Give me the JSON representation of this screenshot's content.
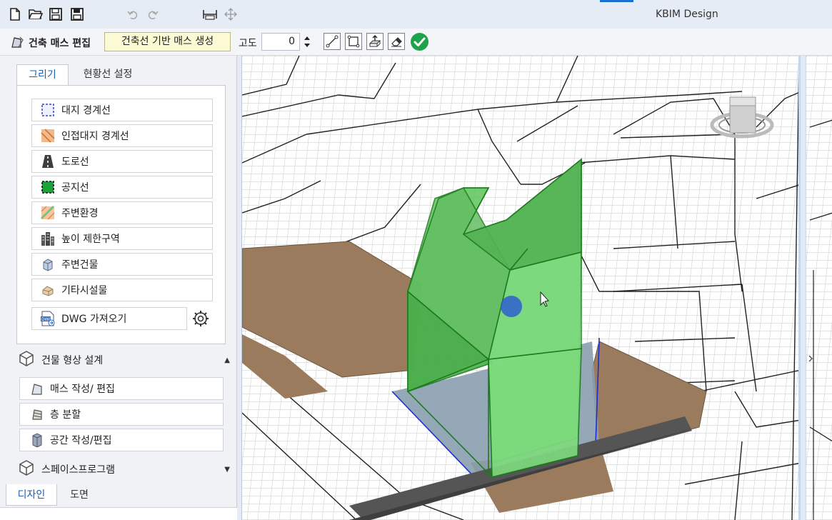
{
  "app": {
    "title": "KBIM Design"
  },
  "quick_access": [
    {
      "name": "new-file-icon"
    },
    {
      "name": "open-folder-icon"
    },
    {
      "name": "save-icon"
    },
    {
      "name": "save-all-icon"
    },
    {
      "name": "undo-icon"
    },
    {
      "name": "redo-icon"
    },
    {
      "name": "measure-icon"
    },
    {
      "name": "move-icon"
    }
  ],
  "toolbar": {
    "mode_label": "건축 매스 편집",
    "generate_button": "건축선 기반 매스 생성",
    "altitude_label": "고도",
    "altitude_value": "0",
    "tools": [
      "line-tool-icon",
      "rectangle-tool-icon",
      "extrude-tool-icon",
      "eraser-tool-icon"
    ],
    "confirm_color": "#1fa34a"
  },
  "left_panel": {
    "tabs": [
      {
        "label": "그리기",
        "active": true
      },
      {
        "label": "현황선 설정",
        "active": false
      }
    ],
    "draw_items": [
      {
        "label": "대지 경계선",
        "icon": "site-boundary-icon"
      },
      {
        "label": "인접대지 경계선",
        "icon": "adjacent-site-boundary-icon"
      },
      {
        "label": "도로선",
        "icon": "road-icon"
      },
      {
        "label": "공지선",
        "icon": "open-space-icon"
      },
      {
        "label": "주변환경",
        "icon": "surroundings-icon"
      },
      {
        "label": "높이 제한구역",
        "icon": "height-limit-icon"
      },
      {
        "label": "주변건물",
        "icon": "nearby-building-icon"
      },
      {
        "label": "기타시설물",
        "icon": "other-facility-icon"
      }
    ],
    "dwg_import": "DWG 가져오기",
    "sections": [
      {
        "label": "건물 형상 설계",
        "expanded": true
      },
      {
        "label": "스페이스프로그램",
        "expanded": false
      }
    ],
    "building_items": [
      {
        "label": "매스 작성/ 편집",
        "icon": "mass-edit-icon"
      },
      {
        "label": "층 분할",
        "icon": "floor-split-icon"
      },
      {
        "label": "공간 작성/편집",
        "icon": "space-edit-icon"
      }
    ],
    "bottom_tabs": [
      {
        "label": "디자인",
        "active": true
      },
      {
        "label": "도면",
        "active": false
      }
    ]
  },
  "viewport": {
    "site_color": "#9b7b5e",
    "mass_color": "#5cc45c",
    "grid_color": "#cfcfcf"
  }
}
